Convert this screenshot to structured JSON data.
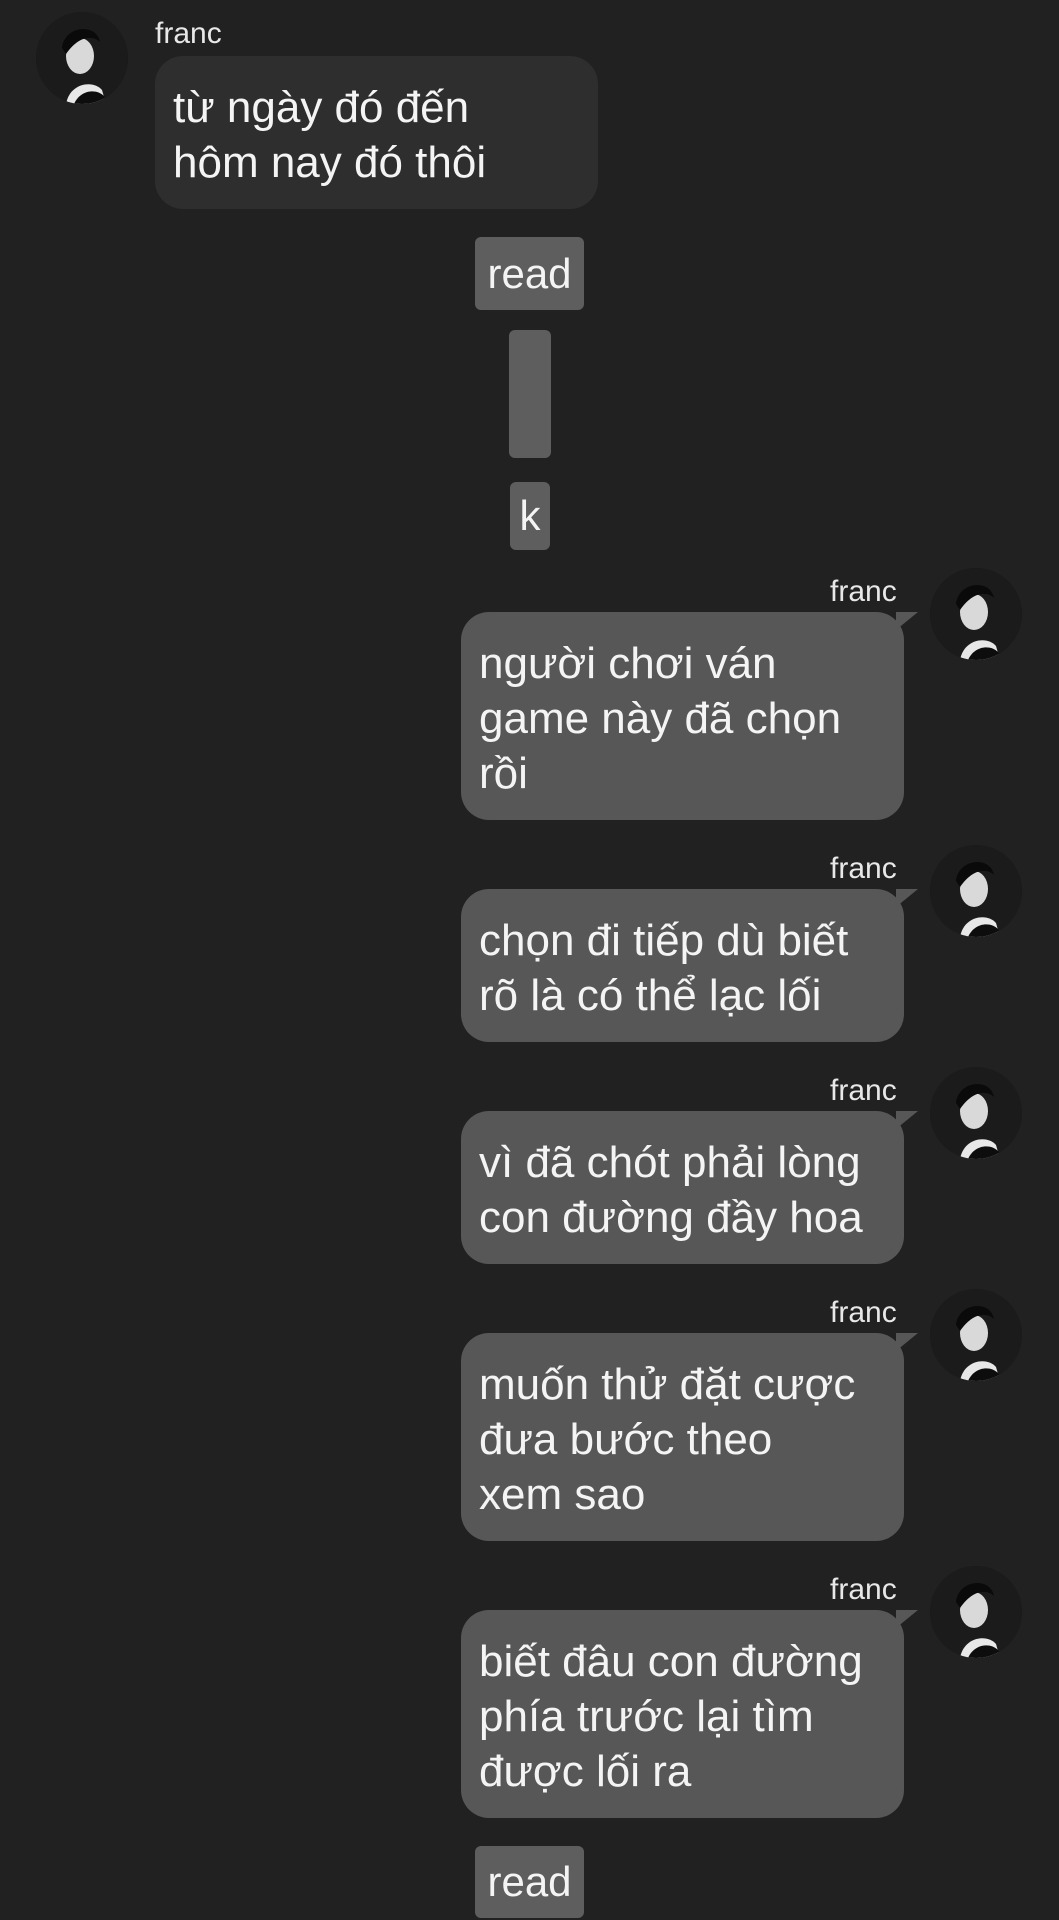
{
  "conversation": {
    "incoming": {
      "sender": "franc",
      "text": "từ ngày đó đến\nhôm nay đó thôi"
    },
    "status_top": "read",
    "blank_message": "",
    "k_message": "k",
    "outgoing": [
      {
        "sender": "franc",
        "text": "người chơi ván\ngame này đã chọn\nrồi"
      },
      {
        "sender": "franc",
        "text": "chọn đi tiếp dù biết\nrõ là có thể lạc lối"
      },
      {
        "sender": "franc",
        "text": "vì đã chót phải lòng\ncon đường đầy hoa"
      },
      {
        "sender": "franc",
        "text": "muốn thử đặt cược\nđưa bước theo\nxem sao"
      },
      {
        "sender": "franc",
        "text": "biết đâu con đường\nphía trước lại tìm\nđược lối ra"
      }
    ],
    "status_bottom": "read"
  },
  "colors": {
    "background": "#212121",
    "incoming_bubble": "#2e2e2e",
    "outgoing_bubble": "#575757",
    "status_pill": "#5e5e5e"
  },
  "icons": {
    "avatar": "profile-photo-avatar"
  }
}
